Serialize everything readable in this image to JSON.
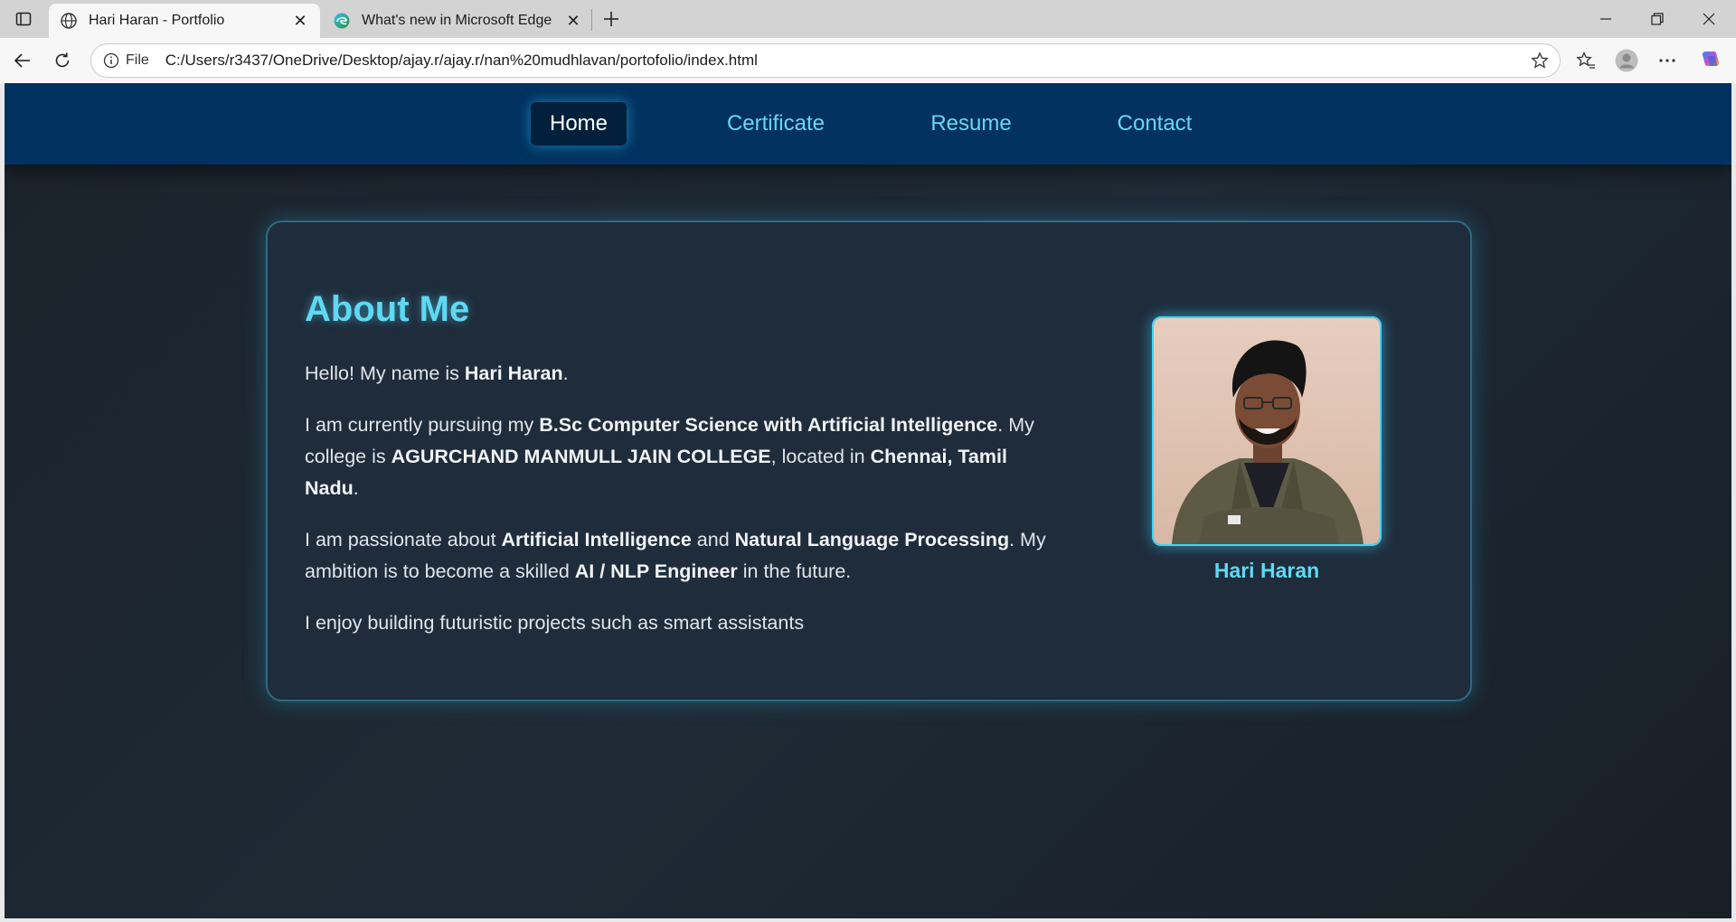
{
  "browser": {
    "tabs": [
      {
        "title": "Hari Haran - Portfolio",
        "active": true,
        "icon": "globe-icon"
      },
      {
        "title": "What's new in Microsoft Edge",
        "active": false,
        "icon": "edge-icon"
      }
    ],
    "address": {
      "scheme": "File",
      "url": "C:/Users/r3437/OneDrive/Desktop/ajay.r/ajay.r/nan%20mudhlavan/portofolio/index.html"
    }
  },
  "site": {
    "nav": [
      {
        "label": "Home",
        "active": true
      },
      {
        "label": "Certificate",
        "active": false
      },
      {
        "label": "Resume",
        "active": false
      },
      {
        "label": "Contact",
        "active": false
      }
    ],
    "about": {
      "title": "About Me",
      "p1": {
        "t1": "Hello! My name is ",
        "b1": "Hari Haran",
        "t2": "."
      },
      "p2": {
        "t1": "I am currently pursuing my ",
        "b1": "B.Sc Computer Science with Artificial Intelligence",
        "t2": ". My college is ",
        "b2": "AGURCHAND MANMULL JAIN COLLEGE",
        "t3": ", located in ",
        "b3": "Chennai, Tamil Nadu",
        "t4": "."
      },
      "p3": {
        "t1": "I am passionate about ",
        "b1": "Artificial Intelligence",
        "t2": " and ",
        "b2": "Natural Language Processing",
        "t3": ". My ambition is to become a skilled ",
        "b3": "AI / NLP Engineer",
        "t4": " in the future."
      },
      "p4": "I enjoy building futuristic projects such as smart assistants"
    },
    "profile": {
      "name": "Hari Haran"
    }
  },
  "colors": {
    "accent": "#5fd9f3",
    "nav_bg": "#033260",
    "card_bg": "#1f2c3b"
  }
}
